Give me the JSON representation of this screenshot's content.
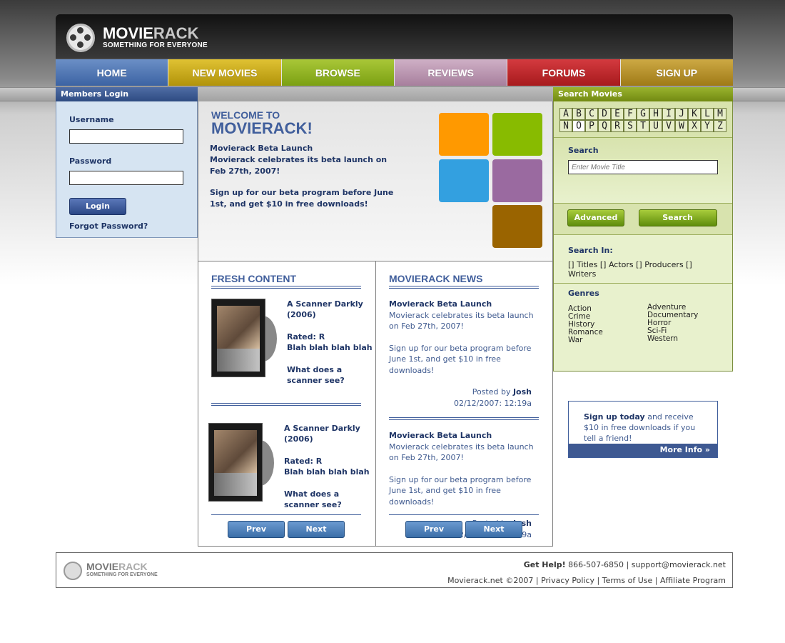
{
  "brand": {
    "name_main": "MOVIE",
    "name_accent": "RACK",
    "tagline": "SOMETHING FOR EVERYONE"
  },
  "nav": {
    "home": "HOME",
    "new_movies": "NEW MOVIES",
    "browse": "BROWSE",
    "reviews": "REVIEWS",
    "forums": "FORUMS",
    "signup": "SIGN UP"
  },
  "login": {
    "header": "Members Login",
    "username_label": "Username",
    "password_label": "Password",
    "login_button": "Login",
    "forgot": "Forgot Password?"
  },
  "welcome": {
    "line1": "WELCOME TO",
    "line2": "MOVIERACK!",
    "p1_title": "Movierack Beta Launch",
    "p1_body": "Movierack celebrates its beta launch on Feb 27th, 2007!",
    "p2": "Sign up for our beta program before June 1st, and get $10 in free downloads!",
    "tile_colors": [
      "#ff9900",
      "#88bb00",
      "#33a0e0",
      "#9a6aa0",
      "#9a6400"
    ]
  },
  "fresh": {
    "title": "FRESH CONTENT",
    "movies": [
      {
        "title": "A Scanner Darkly (2006)",
        "rating": "Rated: R",
        "blurb": "Blah blah blah blah",
        "question": "What does a scanner see?"
      },
      {
        "title": "A Scanner Darkly (2006)",
        "rating": "Rated: R",
        "blurb": "Blah blah blah blah",
        "question": "What does a scanner see?"
      }
    ],
    "prev": "Prev",
    "next": "Next"
  },
  "news": {
    "title": "MOVIERACK NEWS",
    "items": [
      {
        "title": "Movierack Beta Launch",
        "body": "Movierack celebrates its beta launch on Feb 27th, 2007!",
        "body2": "Sign up for our beta program before June 1st, and get $10 in free downloads!",
        "posted_by_label": "Posted by",
        "author": "Josh",
        "date": "02/12/2007: 12:19a"
      },
      {
        "title": "Movierack Beta Launch",
        "body": "Movierack celebrates its beta launch on Feb 27th, 2007!",
        "body2": "Sign up for our beta program before June 1st, and get $10 in free downloads!",
        "posted_by_label": "Posted by",
        "author": "Josh",
        "date": "02/12/2007: 12:19a"
      }
    ],
    "prev": "Prev",
    "next": "Next"
  },
  "search": {
    "header": "Search Movies",
    "letters_row1": [
      "A",
      "B",
      "C",
      "D",
      "E",
      "F",
      "G",
      "H",
      "I",
      "J",
      "K",
      "L",
      "M"
    ],
    "letters_row2": [
      "N",
      "O",
      "P",
      "Q",
      "R",
      "S",
      "T",
      "U",
      "V",
      "W",
      "X",
      "Y",
      "Z"
    ],
    "search_label": "Search",
    "placeholder": "Enter Movie Title",
    "advanced_button": "Advanced",
    "search_button": "Search",
    "search_in_label": "Search In:",
    "search_in_options": "[] Titles [] Actors [] Producers [] Writers",
    "genres_label": "Genres",
    "genres_left": [
      "Action",
      "Crime",
      "History",
      "Romance",
      "War"
    ],
    "genres_right": [
      "Adventure",
      "Documentary",
      "Horror",
      "Sci-Fi",
      "Western"
    ]
  },
  "promo": {
    "strong": "Sign up today",
    "text": " and receive $10 in free downloads if you tell a friend!",
    "more": "More Info »"
  },
  "footer": {
    "get_help": "Get Help!",
    "phone": "866-507-6850",
    "email": "support@movierack.net",
    "copyright": "Movierack.net ©2007",
    "privacy": "Privacy Policy",
    "terms": "Terms of Use",
    "affiliate": "Affiliate Program"
  }
}
